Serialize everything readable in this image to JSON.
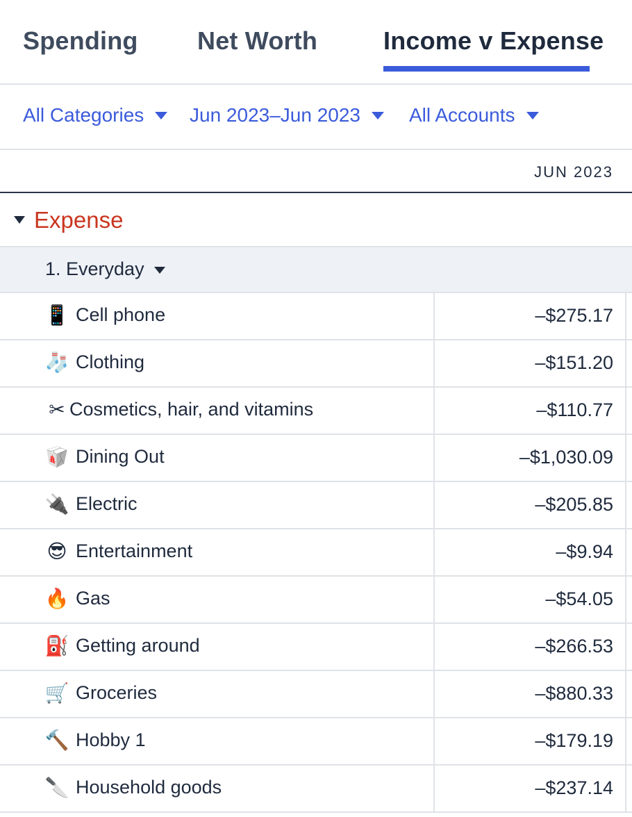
{
  "tabs": [
    {
      "label": "Spending"
    },
    {
      "label": "Net Worth"
    },
    {
      "label": "Income v Expense"
    }
  ],
  "active_tab": "Income v Expense",
  "accent_color": "#3b5bdb",
  "filters": {
    "categories": "All Categories",
    "date_range": "Jun 2023–Jun 2023",
    "accounts": "All Accounts"
  },
  "column_header": "JUN 2023",
  "group": {
    "label": "Expense",
    "color": "#c9361f"
  },
  "subgroup": {
    "label": "1. Everyday"
  },
  "rows": [
    {
      "icon": "📱",
      "icon_name": "mobile-phone-icon",
      "name": "Cell phone",
      "amount": "–$275.17"
    },
    {
      "icon": "🧦",
      "icon_name": "socks-icon",
      "name": "Clothing",
      "amount": "–$151.20"
    },
    {
      "icon": "✂",
      "icon_name": "scissors-icon",
      "name": "Cosmetics, hair, and vitamins",
      "amount": "–$110.77"
    },
    {
      "icon": "🥡",
      "icon_name": "takeout-box-icon",
      "name": "Dining Out",
      "amount": "–$1,030.09"
    },
    {
      "icon": "🔌",
      "icon_name": "electric-plug-icon",
      "name": "Electric",
      "amount": "–$205.85"
    },
    {
      "icon": "😎",
      "icon_name": "sunglasses-face-icon",
      "name": "Entertainment",
      "amount": "–$9.94"
    },
    {
      "icon": "🔥",
      "icon_name": "fire-icon",
      "name": "Gas",
      "amount": "–$54.05"
    },
    {
      "icon": "⛽",
      "icon_name": "fuel-pump-icon",
      "name": "Getting around",
      "amount": "–$266.53"
    },
    {
      "icon": "🛒",
      "icon_name": "shopping-cart-icon",
      "name": "Groceries",
      "amount": "–$880.33"
    },
    {
      "icon": "🔨",
      "icon_name": "hammer-icon",
      "name": "Hobby 1",
      "amount": "–$179.19"
    },
    {
      "icon": "🔪",
      "icon_name": "kitchen-knife-icon",
      "name": "Household goods",
      "amount": "–$237.14"
    }
  ]
}
